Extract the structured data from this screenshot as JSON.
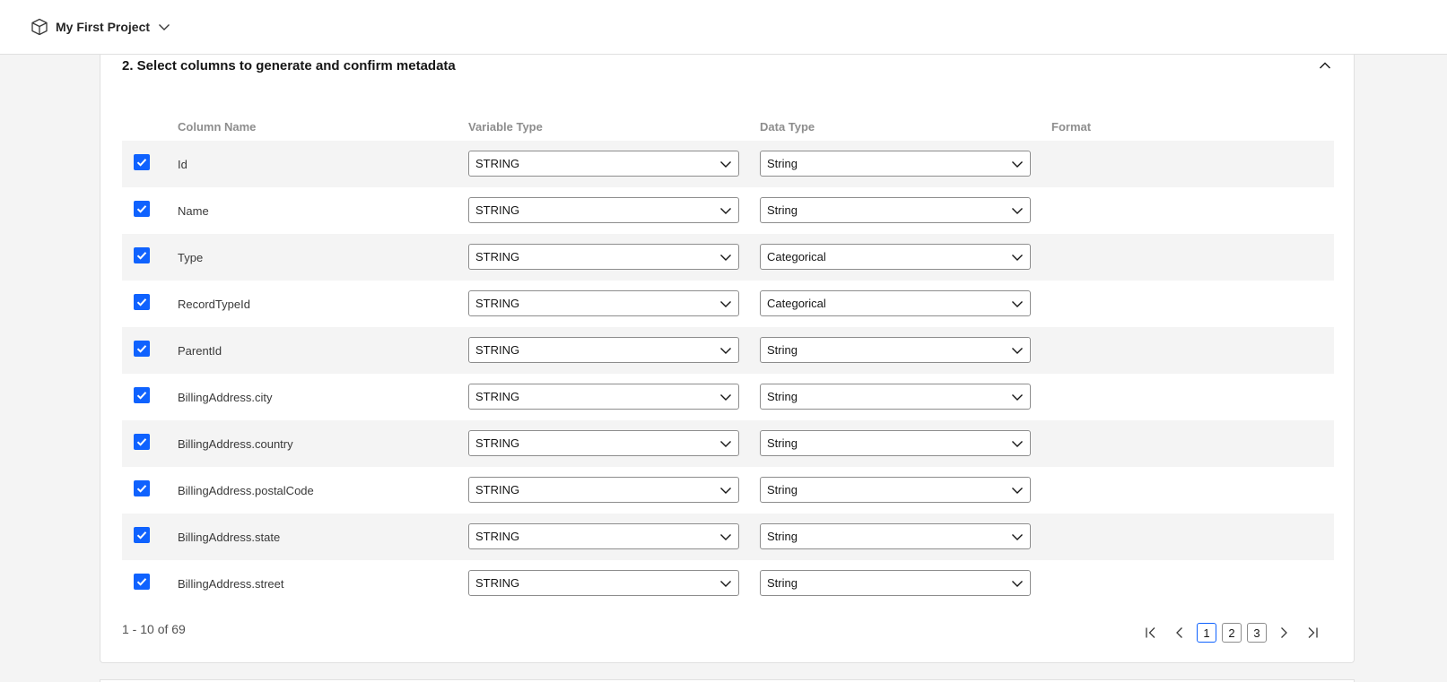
{
  "header": {
    "project_name": "My First Project",
    "project_icon": "cube-icon",
    "switch_icon": "chevron-down-icon"
  },
  "panel": {
    "title": "2. Select columns to generate and confirm metadata",
    "collapse_icon": "chevron-up-icon"
  },
  "table": {
    "headers": {
      "column_name": "Column Name",
      "variable_type": "Variable Type",
      "data_type": "Data Type",
      "format": "Format"
    },
    "rows": [
      {
        "checked": true,
        "name": "Id",
        "variable_type": "STRING",
        "data_type": "String",
        "format": ""
      },
      {
        "checked": true,
        "name": "Name",
        "variable_type": "STRING",
        "data_type": "String",
        "format": ""
      },
      {
        "checked": true,
        "name": "Type",
        "variable_type": "STRING",
        "data_type": "Categorical",
        "format": ""
      },
      {
        "checked": true,
        "name": "RecordTypeId",
        "variable_type": "STRING",
        "data_type": "Categorical",
        "format": ""
      },
      {
        "checked": true,
        "name": "ParentId",
        "variable_type": "STRING",
        "data_type": "String",
        "format": ""
      },
      {
        "checked": true,
        "name": "BillingAddress.city",
        "variable_type": "STRING",
        "data_type": "String",
        "format": ""
      },
      {
        "checked": true,
        "name": "BillingAddress.country",
        "variable_type": "STRING",
        "data_type": "String",
        "format": ""
      },
      {
        "checked": true,
        "name": "BillingAddress.postalCode",
        "variable_type": "STRING",
        "data_type": "String",
        "format": ""
      },
      {
        "checked": true,
        "name": "BillingAddress.state",
        "variable_type": "STRING",
        "data_type": "String",
        "format": ""
      },
      {
        "checked": true,
        "name": "BillingAddress.street",
        "variable_type": "STRING",
        "data_type": "String",
        "format": ""
      }
    ]
  },
  "pagination": {
    "range_text": "1 - 10 of 69",
    "pages": [
      "1",
      "2",
      "3"
    ],
    "current_page": "1"
  },
  "colors": {
    "accent": "#0f62fe",
    "row_alt": "#f4f4f4"
  }
}
